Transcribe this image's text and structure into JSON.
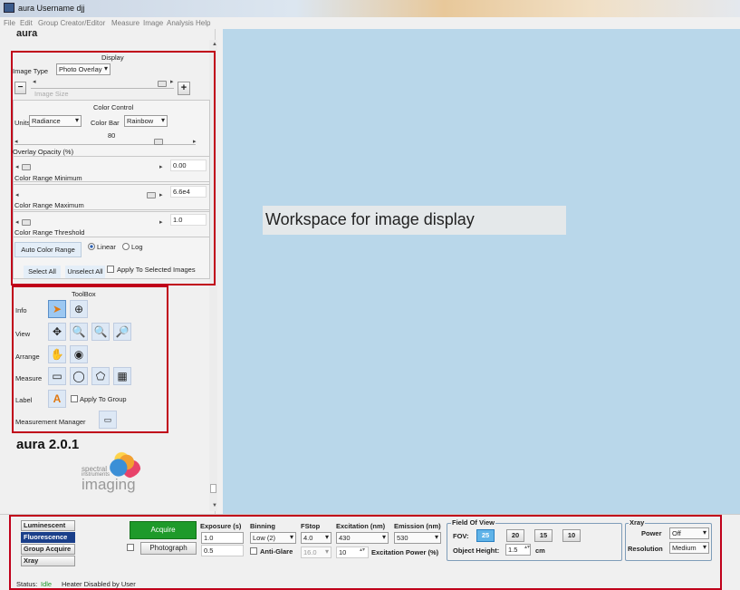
{
  "window": {
    "title": "aura  Username djj"
  },
  "menu": [
    "File",
    "Edit",
    "Group Creator/Editor",
    "Measure",
    "Image",
    "Analysis",
    "Help"
  ],
  "app_name": "aura",
  "display": {
    "title": "Display",
    "image_type_label": "Image Type",
    "image_type_value": "Photo Overlay",
    "image_size_label": "Image Size",
    "minus": "−",
    "plus": "+"
  },
  "color_control": {
    "title": "Color Control",
    "units_label": "Units",
    "units_value": "Radiance",
    "colorbar_label": "Color Bar",
    "colorbar_value": "Rainbow",
    "opacity_value": "80",
    "opacity_label": "Overlay Opacity (%)",
    "min_value": "0.00",
    "min_label": "Color Range Minimum",
    "max_value": "6.6e4",
    "max_label": "Color Range Maximum",
    "thr_value": "1.0",
    "thr_label": "Color Range Threshold",
    "auto_btn": "Auto Color Range",
    "linear": "Linear",
    "log": "Log",
    "select_all": "Select All",
    "unselect_all": "Unselect All",
    "apply_selected": "Apply To Selected Images"
  },
  "toolbox": {
    "title": "ToolBox",
    "info": "Info",
    "view": "View",
    "arrange": "Arrange",
    "measure": "Measure",
    "label": "Label",
    "apply_group": "Apply To Group",
    "manager": "Measurement Manager"
  },
  "version": "aura 2.0.1",
  "logo": {
    "line1": "spectral",
    "line2": "instruments",
    "line3": "imaging"
  },
  "workspace_text": "Workspace for image display",
  "modes": [
    "Luminescent",
    "Fluorescence",
    "Group Acquire",
    "Xray"
  ],
  "acquire": {
    "acquire_btn": "Acquire",
    "photograph_btn": "Photograph"
  },
  "exposure": {
    "label": "Exposure (s)",
    "v1": "1.0",
    "v2": "0.5"
  },
  "binning": {
    "label": "Binning",
    "value": "Low     (2)",
    "antiglare": "Anti-Glare"
  },
  "fstop": {
    "label": "FStop",
    "value": "4.0",
    "v2": "16.0"
  },
  "excitation": {
    "label": "Excitation (nm)",
    "value": "430",
    "power_value": "10",
    "power_label": "Excitation Power (%)"
  },
  "emission": {
    "label": "Emission (nm)",
    "value": "530"
  },
  "fov": {
    "legend": "Field Of View",
    "label": "FOV:",
    "options": [
      "25",
      "20",
      "15",
      "10"
    ],
    "height_label": "Object Height:",
    "height_value": "1.5",
    "unit": "cm"
  },
  "xray": {
    "legend": "Xray",
    "power_label": "Power",
    "power_value": "Off",
    "res_label": "Resolution",
    "res_value": "Medium"
  },
  "status": {
    "prefix": "Status:",
    "state": "Idle",
    "message": "Heater Disabled by User"
  },
  "colors": {
    "workspace": "#b9d7ea",
    "highlight": "#c0001a",
    "acquire": "#1e9a2a",
    "mode_selected": "#1a3f8a"
  }
}
